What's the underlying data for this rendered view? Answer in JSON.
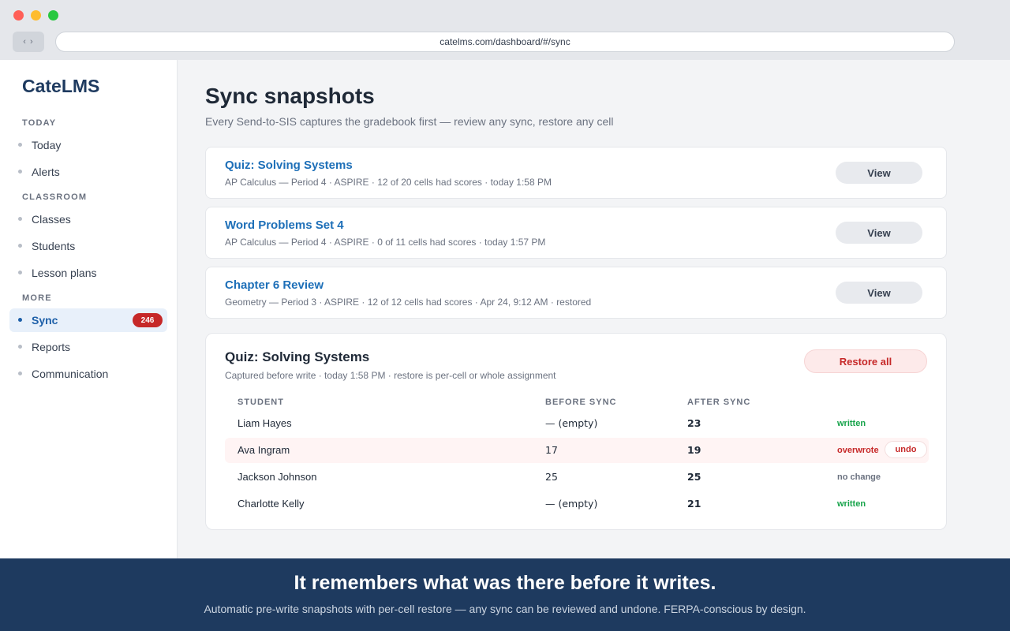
{
  "browser": {
    "url": "catelms.com/dashboard/#/sync",
    "nav_glyph": "‹ ›"
  },
  "sidebar": {
    "brand": "CateLMS",
    "sections": [
      {
        "label": "TODAY",
        "items": [
          {
            "label": "Today"
          },
          {
            "label": "Alerts"
          }
        ]
      },
      {
        "label": "CLASSROOM",
        "items": [
          {
            "label": "Classes"
          },
          {
            "label": "Students"
          },
          {
            "label": "Lesson plans"
          }
        ]
      },
      {
        "label": "MORE",
        "items": [
          {
            "label": "Sync",
            "badge": "246",
            "active": true
          },
          {
            "label": "Reports"
          },
          {
            "label": "Communication"
          }
        ]
      }
    ]
  },
  "page": {
    "title": "Sync snapshots",
    "subtitle": "Every Send-to-SIS captures the gradebook first — review any sync, restore any cell"
  },
  "snapshots": [
    {
      "title": "Quiz: Solving Systems",
      "meta": "AP Calculus — Period 4 · ASPIRE · 12 of 20 cells had scores · today 1:58 PM",
      "button": "View"
    },
    {
      "title": "Word Problems Set 4",
      "meta": "AP Calculus — Period 4 · ASPIRE · 0 of 11 cells had scores · today 1:57 PM",
      "button": "View"
    },
    {
      "title": "Chapter 6 Review",
      "meta": "Geometry — Period 3 · ASPIRE · 12 of 12 cells had scores · Apr 24, 9:12 AM · restored",
      "button": "View"
    }
  ],
  "detail": {
    "title": "Quiz: Solving Systems",
    "meta": "Captured before write · today 1:58 PM · restore is per-cell or whole assignment",
    "restore_label": "Restore all",
    "columns": {
      "student": "STUDENT",
      "before": "BEFORE SYNC",
      "after": "AFTER SYNC"
    },
    "rows": [
      {
        "student": "Liam Hayes",
        "before": "— (empty)",
        "after": "23",
        "status": "written"
      },
      {
        "student": "Ava Ingram",
        "before": "17",
        "after": "19",
        "status": "overwrote",
        "action": "undo"
      },
      {
        "student": "Jackson Johnson",
        "before": "25",
        "after": "25",
        "status": "no change"
      },
      {
        "student": "Charlotte Kelly",
        "before": "— (empty)",
        "after": "21",
        "status": "written"
      }
    ]
  },
  "banner": {
    "title": "It remembers what was there before it writes.",
    "subtitle": "Automatic pre-write snapshots with per-cell restore — any sync can be reviewed and undone. FERPA-conscious by design."
  },
  "colors": {
    "brand": "#1e3a5f",
    "link": "#1d6fb8",
    "active_nav": "#1d5fa8",
    "badge": "#c62828",
    "written": "#16a34a",
    "overwrote": "#c62828"
  }
}
